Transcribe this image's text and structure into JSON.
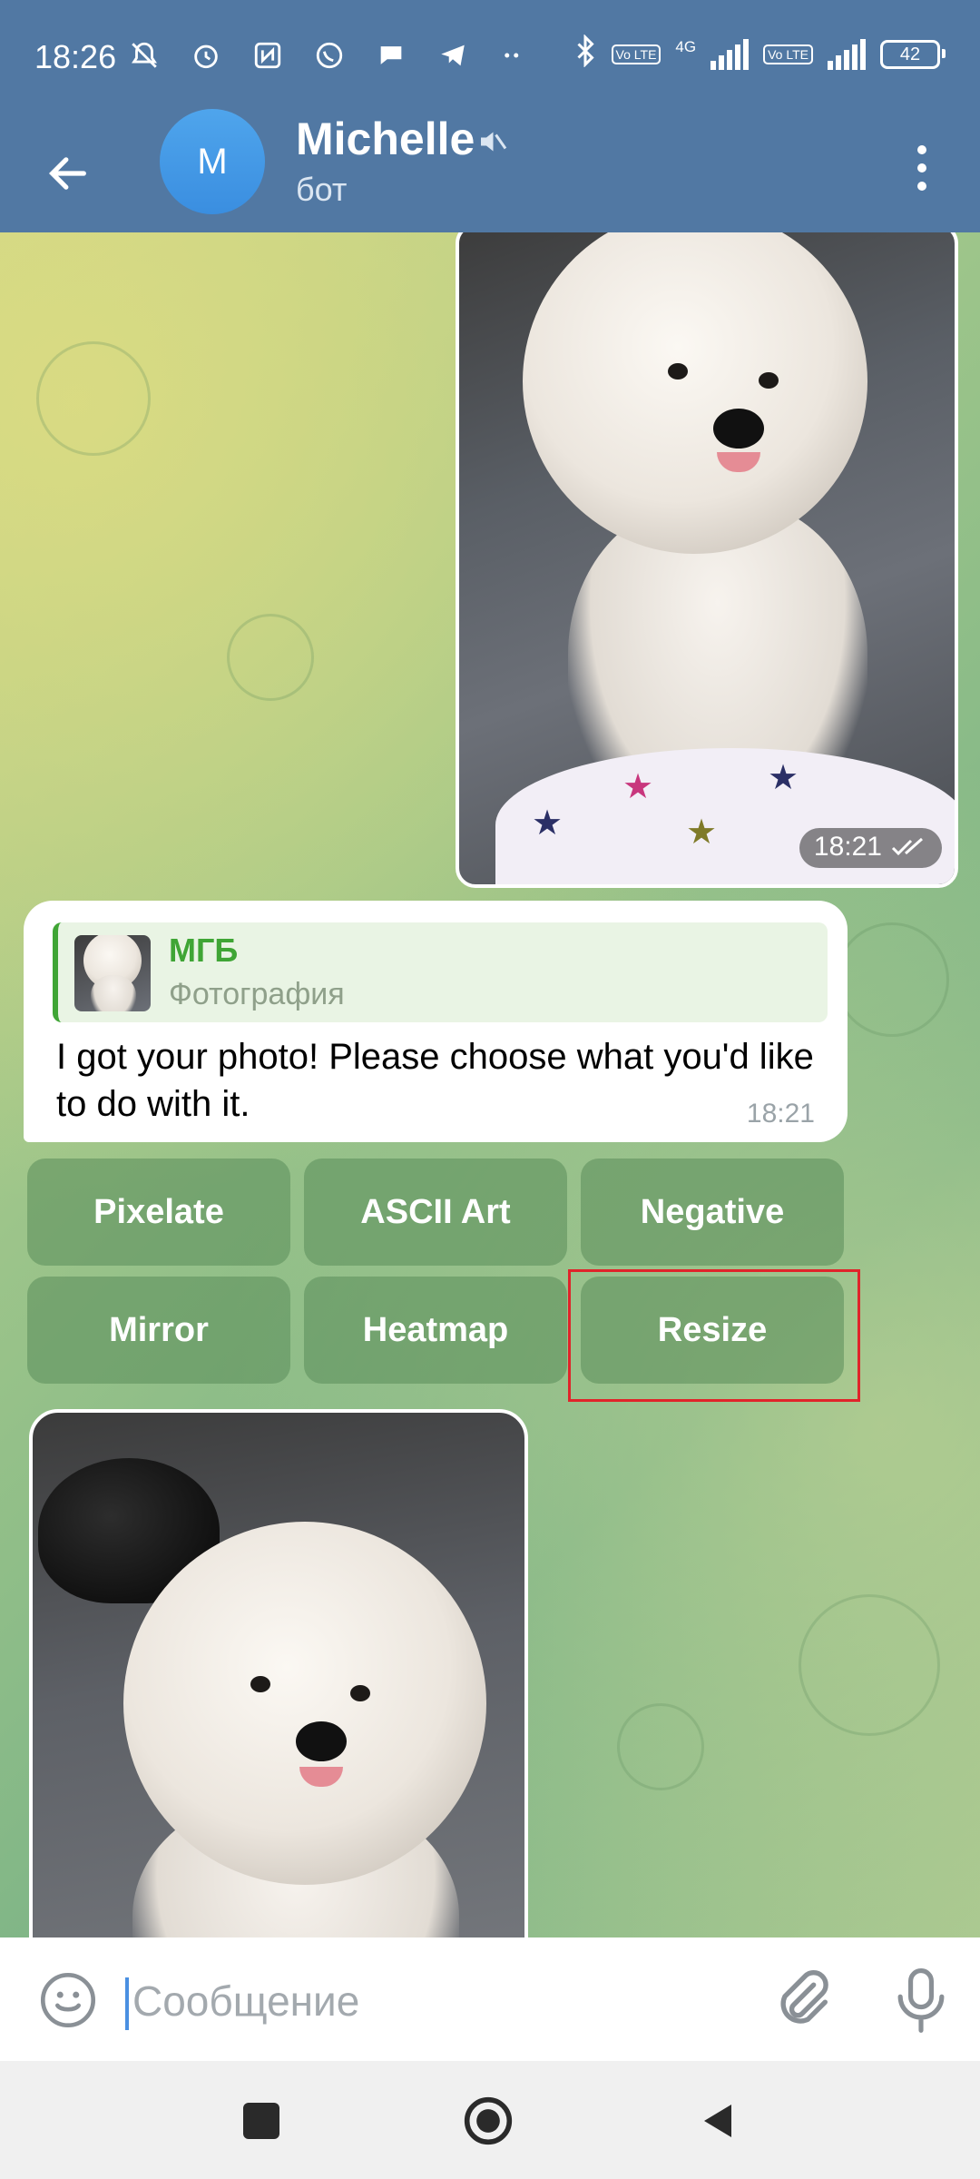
{
  "status_bar": {
    "time": "18:26",
    "battery": "42",
    "network": "4G",
    "volte_badge": "Vo LTE",
    "left_icons": [
      "bell-off",
      "alarm",
      "nfc",
      "whatsapp",
      "chat",
      "telegram",
      "more"
    ]
  },
  "header": {
    "avatar_letter": "M",
    "title": "Michelle",
    "subtitle": "бот"
  },
  "messages": {
    "outgoing_photo_time": "18:21",
    "bot_reply": {
      "quoted_author": "МГБ",
      "quoted_text": "Фотография",
      "text": "I got your photo! Please choose what you'd like to do with it.",
      "time": "18:21"
    }
  },
  "keyboard": {
    "row1": [
      "Pixelate",
      "ASCII Art",
      "Negative"
    ],
    "row2": [
      "Mirror",
      "Heatmap",
      "Resize"
    ]
  },
  "input": {
    "placeholder": "Сообщение"
  },
  "colors": {
    "header": "#5178a3",
    "avatar": "#3a8ee0",
    "reply_accent": "#3fa535",
    "highlight": "#e0242a"
  }
}
